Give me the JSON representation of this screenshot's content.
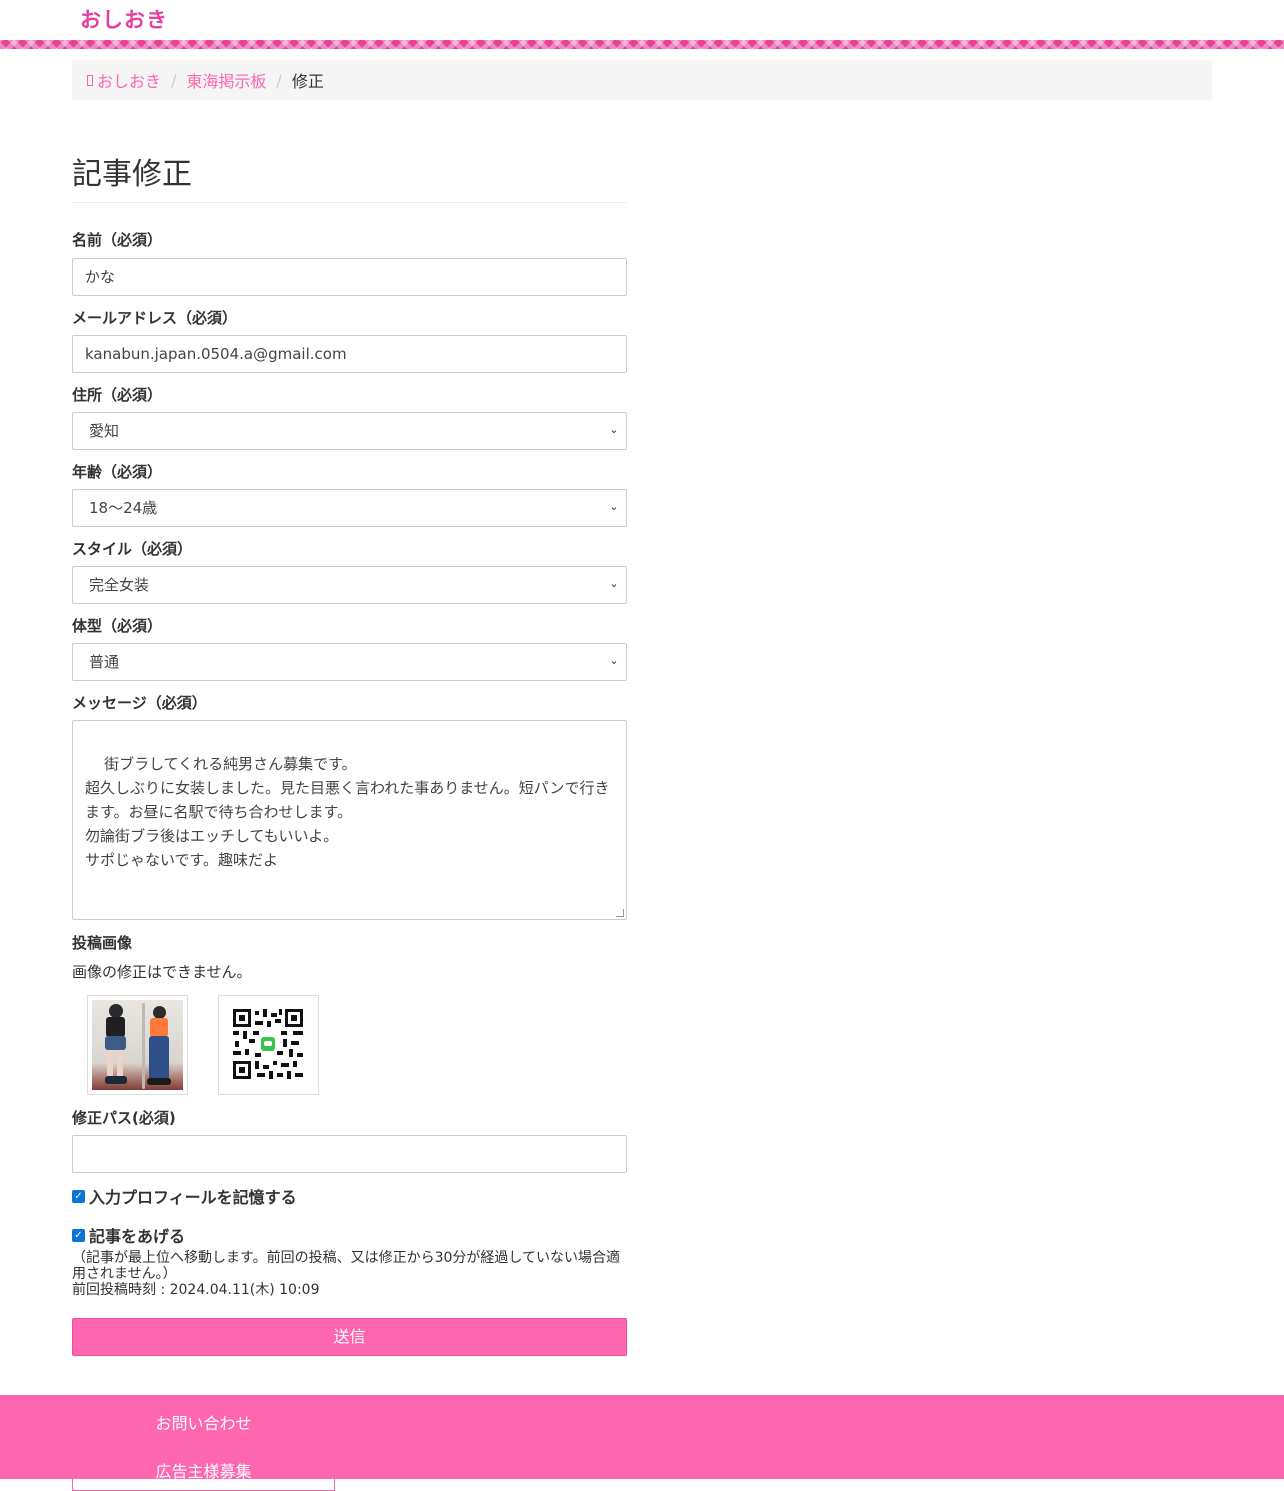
{
  "header": {
    "logo": "おしおき"
  },
  "breadcrumb": {
    "home": "おしおき",
    "board": "東海掲示板",
    "current": "修正"
  },
  "form": {
    "title": "記事修正",
    "name": {
      "label": "名前（必須）",
      "value": "かな"
    },
    "email": {
      "label": "メールアドレス（必須）",
      "value": "kanabun.japan.0504.a@gmail.com"
    },
    "address": {
      "label": "住所（必須）",
      "value": "愛知"
    },
    "age": {
      "label": "年齢（必須）",
      "value": "18〜24歳"
    },
    "style": {
      "label": "スタイル（必須）",
      "value": "完全女装"
    },
    "body": {
      "label": "体型（必須）",
      "value": "普通"
    },
    "message": {
      "label": "メッセージ（必須）",
      "value": "街ブラしてくれる純男さん募集です。\n超久しぶりに女装しました。見た目悪く言われた事ありません。短パンで行きます。お昼に名駅で待ち合わせします。\n勿論街ブラ後はエッチしてもいいよ。\nサポじゃないです。趣味だよ"
    },
    "images": {
      "label": "投稿画像",
      "note": "画像の修正はできません。"
    },
    "password": {
      "label": "修正パス(必須)",
      "value": ""
    },
    "remember": {
      "label": "入力プロフィールを記憶する",
      "checked": true
    },
    "bump": {
      "label": "記事をあげる",
      "checked": true,
      "note": "（記事が最上位へ移動します。前回の投稿、又は修正から30分が経過していない場合適用されません。）",
      "last_post": "前回投稿時刻 : 2024.04.11(木) 10:09"
    },
    "submit": "送信"
  },
  "footer": {
    "contact": "お問い合わせ",
    "ads": "広告主様募集"
  },
  "colors": {
    "brand": "#e83e9f",
    "accent": "#ff66b0",
    "checkbox": "#0a74d9"
  },
  "icons": {
    "home": "home-icon",
    "select": "chevron-down-icon"
  }
}
